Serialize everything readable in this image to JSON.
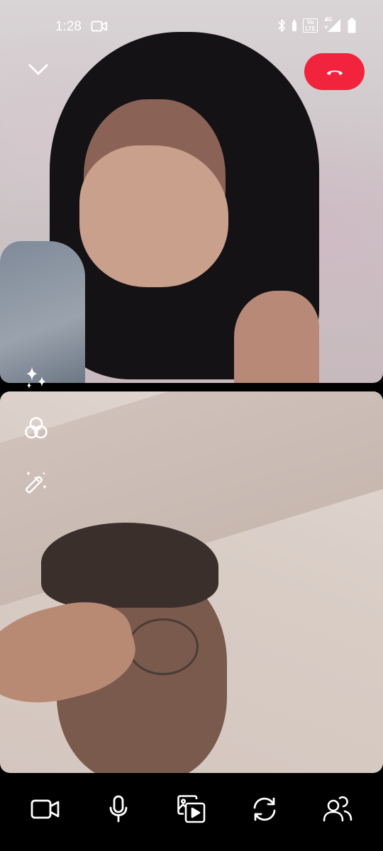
{
  "status_bar": {
    "time": "1:28",
    "network_type": "4G",
    "volte_label_top": "Vo",
    "volte_label_bottom": "LTE"
  },
  "icons": {
    "minimize": "chevron-down-icon",
    "end_call": "phone-hangup-icon",
    "effects": "sparkles-icon",
    "filters": "color-filter-icon",
    "magic_wand": "magic-wand-icon",
    "camera": "video-camera-icon",
    "microphone": "microphone-icon",
    "media_share": "media-share-icon",
    "flip_camera": "flip-camera-icon",
    "participants": "people-icon"
  },
  "colors": {
    "end_call": "#f2243d",
    "toolbar_bg": "#000000",
    "icon": "#ffffff"
  }
}
